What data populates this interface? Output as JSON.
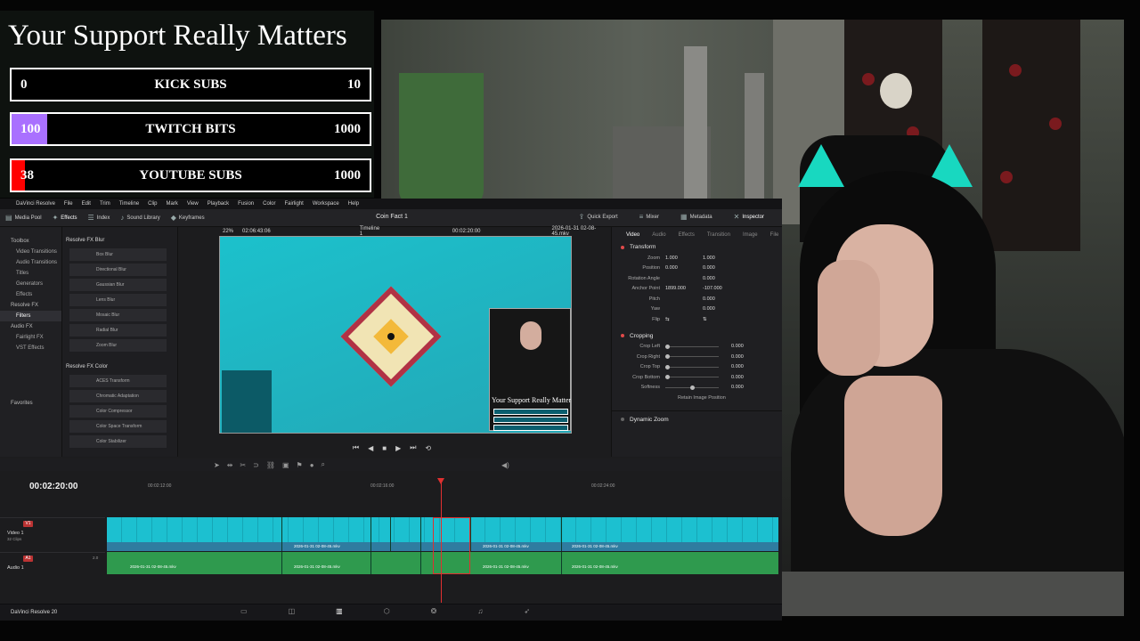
{
  "support": {
    "title": "Your Support Really Matters",
    "goals": [
      {
        "start": "0",
        "label": "KICK SUBS",
        "end": "10",
        "progress": 0.0,
        "color": "#53fc18"
      },
      {
        "start": "100",
        "label": "TWITCH BITS",
        "end": "1000",
        "progress": 0.1,
        "color": "#a970ff"
      },
      {
        "start": "38",
        "label": "YOUTUBE SUBS",
        "end": "1000",
        "progress": 0.038,
        "color": "#ff0000"
      }
    ]
  },
  "resolve": {
    "menu": [
      "DaVinci Resolve",
      "File",
      "Edit",
      "Trim",
      "Timeline",
      "Clip",
      "Mark",
      "View",
      "Playback",
      "Fusion",
      "Color",
      "Fairlight",
      "Workspace",
      "Help"
    ],
    "toolbar": {
      "media_pool": "Media Pool",
      "effects": "Effects",
      "index": "Index",
      "sound_library": "Sound Library",
      "keyframes": "Keyframes",
      "quick_export": "Quick Export",
      "mixer": "Mixer",
      "metadata": "Metadata",
      "inspector": "Inspector"
    },
    "project_title": "Coin Fact 1",
    "fx_tree": [
      "Toolbox",
      "Video Transitions",
      "Audio Transitions",
      "Titles",
      "Generators",
      "Effects",
      "Resolve FX",
      "Filters",
      "Audio FX",
      "Fairlight FX",
      "VST Effects",
      "Favorites"
    ],
    "fx_blur_header": "Resolve FX Blur",
    "fx_blur": [
      "Box Blur",
      "Directional Blur",
      "Gaussian Blur",
      "Lens Blur",
      "Mosaic Blur",
      "Radial Blur",
      "Zoom Blur"
    ],
    "fx_color_header": "Resolve FX Color",
    "fx_color": [
      "ACES Transform",
      "Chromatic Adaptation",
      "Color Compressor",
      "Color Space Transform",
      "Color Stabilizer"
    ],
    "viewer": {
      "zoom": "22%",
      "source_tc": "02:06:43:06",
      "timeline_name": "Timeline 1",
      "record_tc": "00:02:20:00",
      "clip_name": "2026-01-31 02-08-45.mkv"
    },
    "overlay_title": "Your Support Really Matters",
    "inspector": {
      "tabs": [
        "Video",
        "Audio",
        "Effects",
        "Transition",
        "Image",
        "File"
      ],
      "transform_label": "Transform",
      "transform": [
        {
          "label": "Zoom",
          "x": "1.000",
          "y": "1.000"
        },
        {
          "label": "Position",
          "x": "0.000",
          "y": "0.000"
        },
        {
          "label": "Rotation Angle",
          "x": "",
          "y": "0.000"
        },
        {
          "label": "Anchor Point",
          "x": "1899.000",
          "y": "-107.000"
        },
        {
          "label": "Pitch",
          "x": "",
          "y": "0.000"
        },
        {
          "label": "Yaw",
          "x": "",
          "y": "0.000"
        },
        {
          "label": "Flip",
          "x": "",
          "y": ""
        }
      ],
      "cropping_label": "Cropping",
      "cropping": [
        {
          "label": "Crop Left",
          "value": "0.000"
        },
        {
          "label": "Crop Right",
          "value": "0.000"
        },
        {
          "label": "Crop Top",
          "value": "0.000"
        },
        {
          "label": "Crop Bottom",
          "value": "0.000"
        },
        {
          "label": "Softness",
          "value": "0.000"
        }
      ],
      "retain_label": "Retain Image Position",
      "dynamic_zoom_label": "Dynamic Zoom"
    },
    "timeline": {
      "timecode": "00:02:20:00",
      "ruler": [
        "00:02:12:00",
        "00:02:16:00",
        "00:02:24:00"
      ],
      "video_track": {
        "badge": "V1",
        "name": "Video 1",
        "clips_count": "32 Clips"
      },
      "audio_track": {
        "badge": "A1",
        "name": "Audio 1",
        "level": "2.0"
      },
      "clip_label": "2026-01-31 02-08-45.mkv"
    },
    "app_name": "DaVinci Resolve 20"
  }
}
